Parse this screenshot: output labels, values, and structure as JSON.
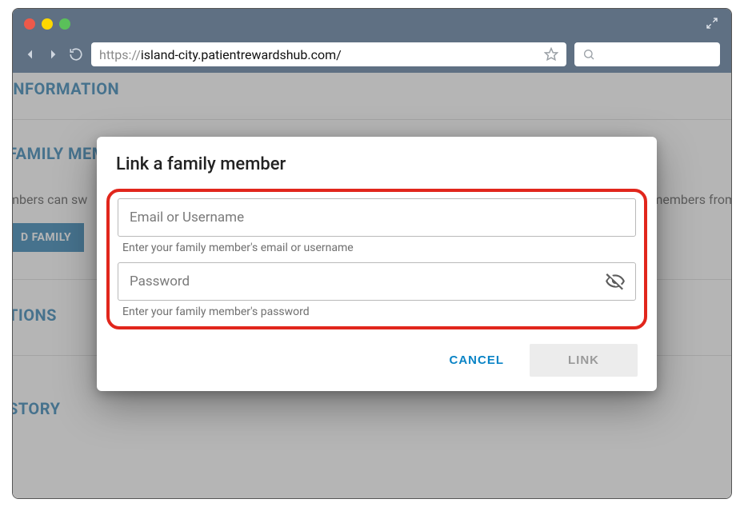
{
  "browser": {
    "url_protocol": "https://",
    "url_rest": "island-city.patientrewardshub.com/",
    "search_placeholder": ""
  },
  "background": {
    "section_information": "INFORMATION",
    "section_family": "FAMILY MEM",
    "family_body_left": "mbers can sw",
    "family_body_right": "members from",
    "add_family_button": "D FAMILY",
    "section_tions": "TIONS",
    "section_story": "STORY"
  },
  "dialog": {
    "title": "Link a family member",
    "email_placeholder": "Email or Username",
    "email_helper": "Enter your family member's email or username",
    "password_placeholder": "Password",
    "password_helper": "Enter your family member's password",
    "cancel_label": "CANCEL",
    "link_label": "LINK"
  }
}
